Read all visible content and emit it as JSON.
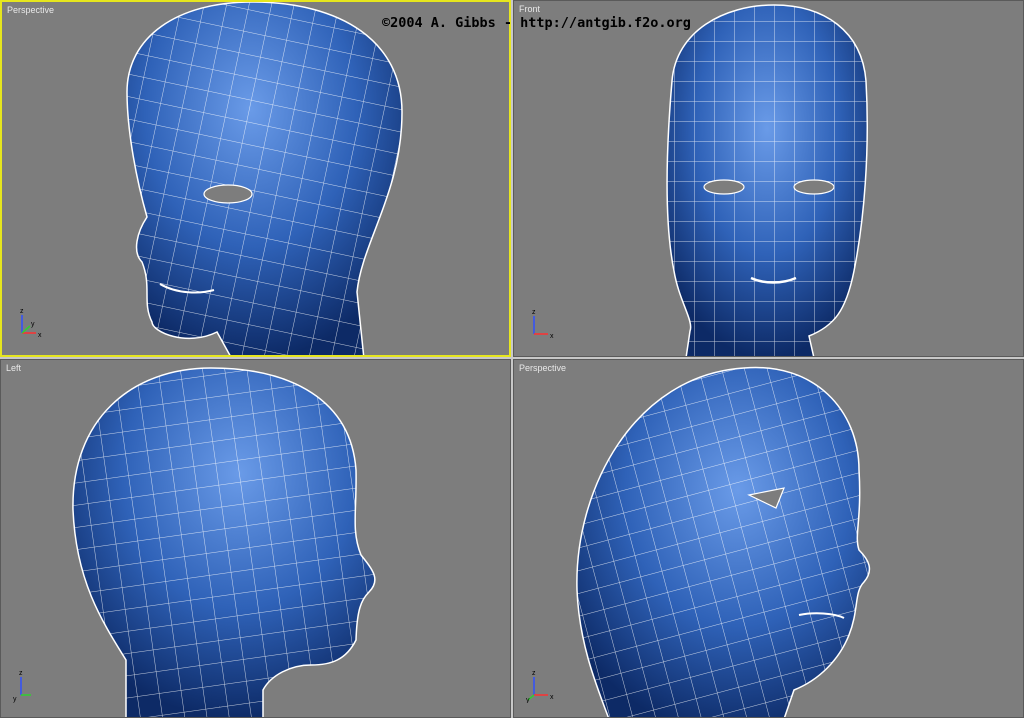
{
  "viewports": [
    {
      "id": "tl",
      "label": "Perspective",
      "active": true
    },
    {
      "id": "tr",
      "label": "Front",
      "active": false
    },
    {
      "id": "bl",
      "label": "Left",
      "active": false
    },
    {
      "id": "br",
      "label": "Perspective",
      "active": false
    }
  ],
  "axis_labels": {
    "tl": [
      "z",
      "y",
      "x"
    ],
    "tr": [
      "z",
      "x"
    ],
    "bl": [
      "z",
      "y"
    ],
    "br": [
      "z",
      "y",
      "x"
    ]
  },
  "credit": "©2004 A. Gibbs - http://antgib.f2o.org",
  "colors": {
    "viewport_bg": "#7d7d7d",
    "active_border": "#e6e61e",
    "mesh_fill": "#2a5cb0",
    "wire": "#ffffff"
  },
  "icons": [
    "axis-tripod-icon",
    "head-mesh-icon"
  ]
}
